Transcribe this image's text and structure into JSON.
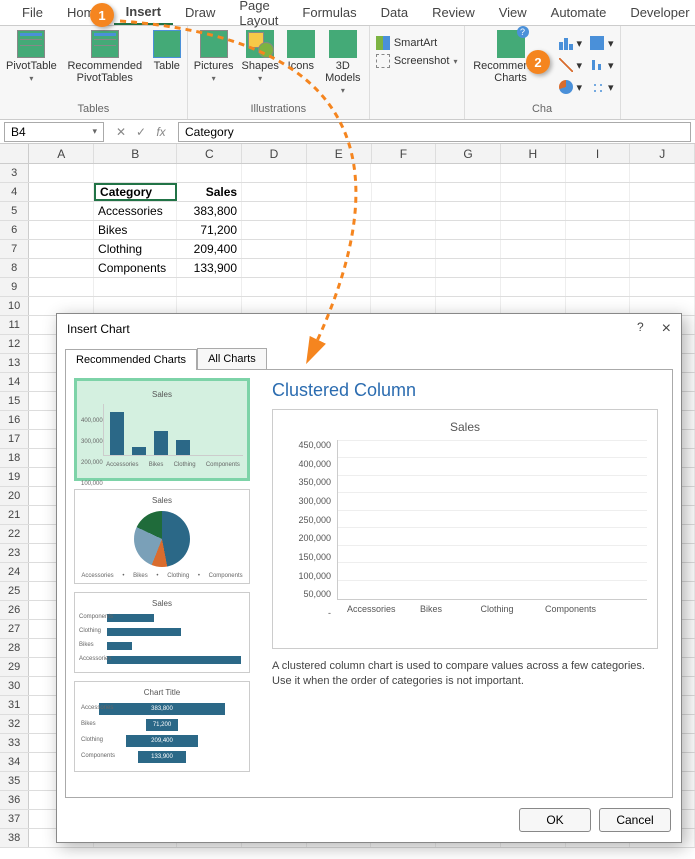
{
  "tabs": [
    "File",
    "Home",
    "Insert",
    "Draw",
    "Page Layout",
    "Formulas",
    "Data",
    "Review",
    "View",
    "Automate",
    "Developer"
  ],
  "active_tab": "Insert",
  "ribbon": {
    "groups": {
      "tables": {
        "label": "Tables",
        "pivot": "PivotTable",
        "recpivot": "Recommended PivotTables",
        "table": "Table"
      },
      "illus": {
        "label": "Illustrations",
        "pictures": "Pictures",
        "shapes": "Shapes",
        "icons": "Icons",
        "models": "3D Models"
      },
      "addins": {
        "smartart": "SmartArt",
        "screenshot": "Screenshot"
      },
      "charts": {
        "label": "Cha",
        "rec": "Recommended Charts"
      }
    }
  },
  "namebox": "B4",
  "formula": "Category",
  "cols": [
    "A",
    "B",
    "C",
    "D",
    "E",
    "F",
    "G",
    "H",
    "I",
    "J"
  ],
  "rows": [
    3,
    4,
    5,
    6,
    7,
    8,
    9,
    10,
    11,
    12,
    13,
    14,
    15,
    16,
    17,
    18,
    19,
    20,
    21,
    22,
    23,
    24,
    25,
    26,
    27,
    28,
    29,
    30,
    31,
    32,
    33,
    34,
    35,
    36,
    37,
    38
  ],
  "table": {
    "header": {
      "B": "Category",
      "C": "Sales"
    },
    "data": [
      {
        "B": "Accessories",
        "C": "383,800"
      },
      {
        "B": "Bikes",
        "C": "71,200"
      },
      {
        "B": "Clothing",
        "C": "209,400"
      },
      {
        "B": "Components",
        "C": "133,900"
      }
    ]
  },
  "callouts": {
    "one": "1",
    "two": "2"
  },
  "dialog": {
    "title": "Insert Chart",
    "help": "?",
    "close": "×",
    "tab_rec": "Recommended Charts",
    "tab_all": "All Charts",
    "preview_heading": "Clustered Column",
    "desc": "A clustered column chart is used to compare values across a few categories. Use it when the order of categories is not important.",
    "ok": "OK",
    "cancel": "Cancel",
    "chart_title": "Sales",
    "thumb_titles": {
      "col": "Sales",
      "pie": "Sales",
      "bar": "Sales",
      "funnel": "Chart Title"
    }
  },
  "chart_data": {
    "type": "bar",
    "title": "Sales",
    "categories": [
      "Accessories",
      "Bikes",
      "Clothing",
      "Components"
    ],
    "values": [
      383800,
      71200,
      209400,
      133900
    ],
    "ylim": [
      0,
      450000
    ],
    "yticks": [
      "450,000",
      "400,000",
      "350,000",
      "300,000",
      "250,000",
      "200,000",
      "150,000",
      "100,000",
      "50,000",
      "-"
    ],
    "xlabel": "",
    "ylabel": ""
  }
}
